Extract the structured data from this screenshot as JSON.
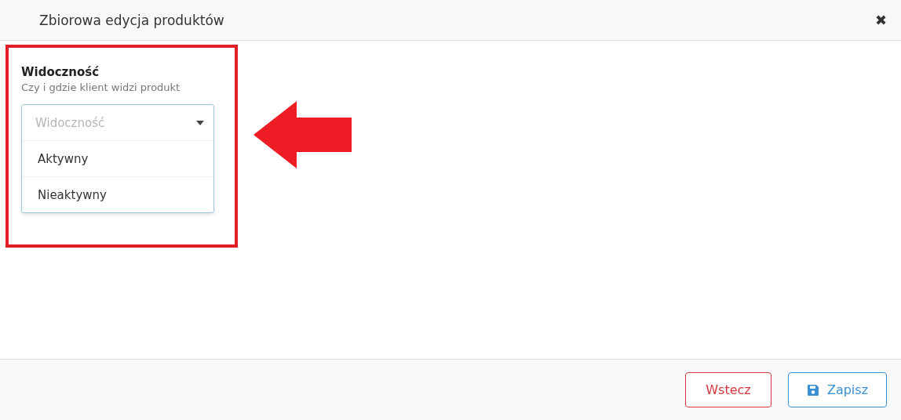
{
  "window": {
    "title": "Zbiorowa edycja produktów",
    "close": "✖"
  },
  "field": {
    "label": "Widoczność",
    "hint": "Czy i gdzie klient widzi produkt",
    "placeholder": "Widoczność",
    "expanded": true,
    "options": [
      {
        "label": "Aktywny",
        "selected": false
      },
      {
        "label": "Nieaktywny",
        "selected": false
      }
    ]
  },
  "buttons": [
    {
      "kind": "back",
      "label": "Wstecz"
    },
    {
      "kind": "save",
      "label": "Zapisz"
    }
  ]
}
